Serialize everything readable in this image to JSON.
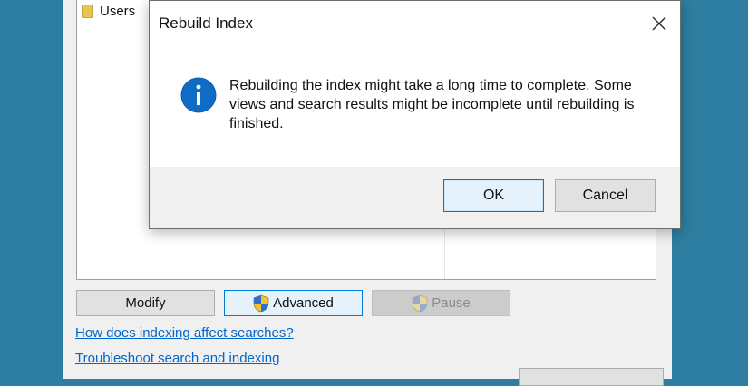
{
  "background_window": {
    "folder_item": "Users",
    "buttons": {
      "modify": "Modify",
      "advanced": "Advanced",
      "pause": "Pause"
    },
    "links": {
      "indexing_affect": "How does indexing affect searches?",
      "troubleshoot": "Troubleshoot search and indexing"
    }
  },
  "dialog": {
    "title": "Rebuild Index",
    "message": "Rebuilding the index might take a long time to complete. Some views and search results might be incomplete until rebuilding is finished.",
    "ok_label": "OK",
    "cancel_label": "Cancel",
    "icon": "info-icon"
  },
  "colors": {
    "desktop": "#2d7ea0",
    "info_blue": "#0f6cc6",
    "link": "#0066cc",
    "focus_border": "#0078d7"
  }
}
